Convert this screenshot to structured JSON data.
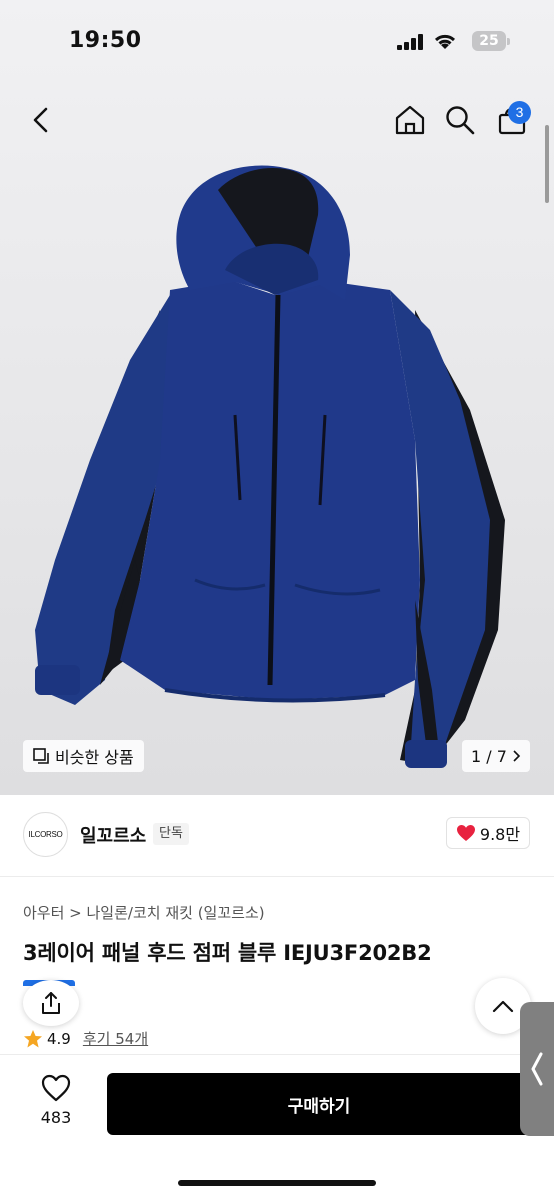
{
  "status_bar": {
    "time": "19:50",
    "battery": "25"
  },
  "header": {
    "cart_count": "3"
  },
  "gallery": {
    "similar_label": "비슷한 상품",
    "page_counter": "1 / 7"
  },
  "brand": {
    "logo_text": "ILCORSO",
    "name": "일꼬르소",
    "tag": "단독",
    "like_count": "9.8만"
  },
  "product": {
    "category_path": "아우터 > 나일론/코치 재킷 (일꼬르소)",
    "title": "3레이어 패널 후드 점퍼 블루 IEJU3F202B2",
    "rating": "4.9",
    "review_label": "후기 54개"
  },
  "bottom_bar": {
    "wish_count": "483",
    "buy_label": "구매하기"
  },
  "colors": {
    "accent_blue": "#1f6fe5",
    "jacket_navy": "#1f3a86",
    "panel_black": "#15171d",
    "heart_red": "#e8223f"
  },
  "icons": [
    "back-arrow-icon",
    "home-icon",
    "search-icon",
    "cart-icon",
    "similar-items-icon",
    "chevron-right-icon",
    "heart-icon",
    "share-icon",
    "chevron-up-icon",
    "star-icon",
    "heart-outline-icon",
    "chevron-left-icon"
  ]
}
